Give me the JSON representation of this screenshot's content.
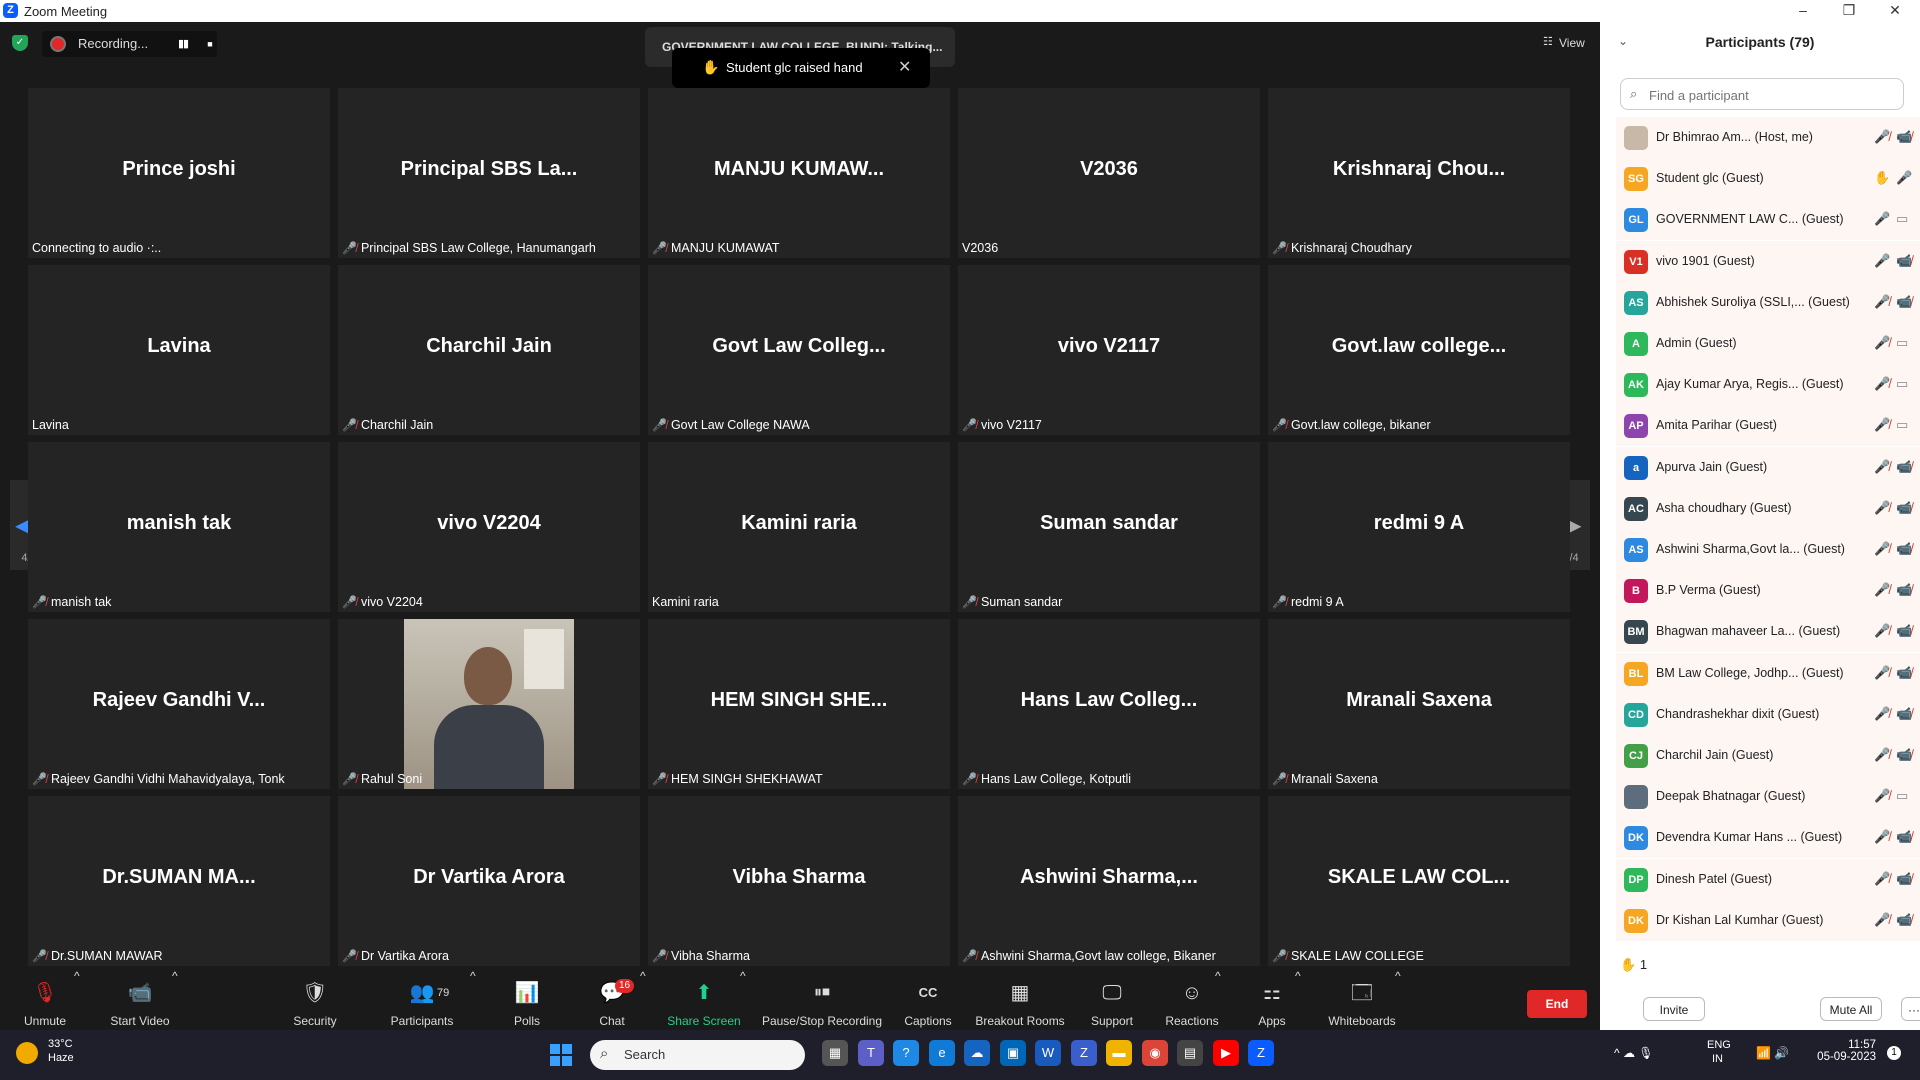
{
  "window": {
    "title": "Zoom Meeting",
    "minimize": "–",
    "restore": "❐",
    "close": "✕"
  },
  "recording": {
    "label": "Recording...",
    "pause": "▮▮",
    "stop": "■"
  },
  "speaker_banner": "GOVERNMENT LAW COLLEGE, BUNDI: Talking...",
  "notification": {
    "icon": "✋",
    "text": "Student glc raised hand",
    "close": "✕"
  },
  "view_button": {
    "icon": "☷",
    "label": "View"
  },
  "page_indicator": {
    "left": "4/4",
    "right": "4/4",
    "left_arrow": "◀",
    "right_arrow": "▶"
  },
  "tiles": [
    {
      "name": "Prince joshi",
      "label": "Connecting to audio ·:..",
      "muted": false
    },
    {
      "name": "Principal SBS La...",
      "label": "Principal SBS Law College, Hanumangarh",
      "muted": true
    },
    {
      "name": "MANJU  KUMAW...",
      "label": "MANJU KUMAWAT",
      "muted": true
    },
    {
      "name": "V2036",
      "label": "V2036",
      "muted": false
    },
    {
      "name": "Krishnaraj  Chou...",
      "label": "Krishnaraj Choudhary",
      "muted": true
    },
    {
      "name": "Lavina",
      "label": "Lavina",
      "muted": false
    },
    {
      "name": "Charchil Jain",
      "label": "Charchil Jain",
      "muted": true
    },
    {
      "name": "Govt  Law  Colleg...",
      "label": "Govt Law College NAWA",
      "muted": true
    },
    {
      "name": "vivo V2117",
      "label": "vivo V2117",
      "muted": true
    },
    {
      "name": "Govt.law  college...",
      "label": "Govt.law college, bikaner",
      "muted": true
    },
    {
      "name": "manish tak",
      "label": "manish tak",
      "muted": true
    },
    {
      "name": "vivo V2204",
      "label": "vivo V2204",
      "muted": true
    },
    {
      "name": "Kamini raria",
      "label": "Kamini raria",
      "muted": false
    },
    {
      "name": "Suman sandar",
      "label": "Suman sandar",
      "muted": true
    },
    {
      "name": "redmi 9 A",
      "label": "redmi 9 A",
      "muted": true
    },
    {
      "name": "Rajeev Gandhi V...",
      "label": "Rajeev Gandhi Vidhi Mahavidyalaya, Tonk",
      "muted": true
    },
    {
      "name": "",
      "label": "Rahul Soni",
      "muted": true,
      "video": true
    },
    {
      "name": "HEM SINGH SHE...",
      "label": "HEM SINGH SHEKHAWAT",
      "muted": true
    },
    {
      "name": "Hans Law Colleg...",
      "label": "Hans Law College, Kotputli",
      "muted": true
    },
    {
      "name": "Mranali Saxena",
      "label": "Mranali Saxena",
      "muted": true
    },
    {
      "name": "Dr.SUMAN  MA...",
      "label": "Dr.SUMAN MAWAR",
      "muted": true
    },
    {
      "name": "Dr Vartika Arora",
      "label": "Dr Vartika Arora",
      "muted": true
    },
    {
      "name": "Vibha Sharma",
      "label": "Vibha Sharma",
      "muted": true
    },
    {
      "name": "Ashwini  Sharma,...",
      "label": "Ashwini Sharma,Govt law college, Bikaner",
      "muted": true
    },
    {
      "name": "SKALE  LAW  COL...",
      "label": "SKALE LAW COLLEGE",
      "muted": true
    }
  ],
  "mute_glyph": "🎤̸",
  "toolbar": {
    "unmute": "Unmute",
    "start_video": "Start Video",
    "security": "Security",
    "participants": "Participants",
    "participants_count": "79",
    "polls": "Polls",
    "chat": "Chat",
    "chat_badge": "16",
    "share_screen": "Share Screen",
    "pause_stop_recording": "Pause/Stop Recording",
    "captions": "Captions",
    "breakout_rooms": "Breakout Rooms",
    "support": "Support",
    "reactions": "Reactions",
    "apps": "Apps",
    "whiteboards": "Whiteboards",
    "end": "End",
    "caret": "^",
    "icons": {
      "unmute": "🎙",
      "start_video": "📹",
      "security": "🛡",
      "participants": "👥",
      "polls": "📊",
      "chat": "💬",
      "share_screen": "⬆",
      "pause_stop_recording": "⏸⏹",
      "captions": "CC",
      "breakout_rooms": "▦",
      "support": "🖵",
      "reactions": "☺",
      "apps": "⚏",
      "whiteboards": "🗔"
    }
  },
  "panel": {
    "title": "Participants (79)",
    "collapse": "⌄",
    "search_placeholder": "Find a participant",
    "participants": [
      {
        "initials": "",
        "name": "Dr Bhimrao Am...  (Host, me)",
        "color": "#c8b8a8",
        "icon1": "🎤̸",
        "icon2": "📹̸"
      },
      {
        "initials": "SG",
        "name": "Student glc (Guest)",
        "color": "#f5a623",
        "icon1": "✋",
        "icon2": "🎤"
      },
      {
        "initials": "GL",
        "name": "GOVERNMENT LAW C...  (Guest)",
        "color": "#2d8ae0",
        "icon1": "🎤",
        "icon2": "▭"
      },
      {
        "initials": "V1",
        "name": "vivo 1901 (Guest)",
        "color": "#d93025",
        "icon1": "🎤",
        "icon2": "📹̸"
      },
      {
        "initials": "AS",
        "name": "Abhishek Suroliya (SSLI,...  (Guest)",
        "color": "#26a69a",
        "icon1": "🎤̸",
        "icon2": "📹̸"
      },
      {
        "initials": "A",
        "name": "Admin (Guest)",
        "color": "#2eb85c",
        "icon1": "🎤̸",
        "icon2": "▭"
      },
      {
        "initials": "AK",
        "name": "Ajay Kumar Arya, Regis...  (Guest)",
        "color": "#2eb85c",
        "icon1": "🎤̸",
        "icon2": "▭"
      },
      {
        "initials": "AP",
        "name": "Amita Parihar (Guest)",
        "color": "#8e44ad",
        "icon1": "🎤̸",
        "icon2": "▭"
      },
      {
        "initials": "a",
        "name": "Apurva Jain (Guest)",
        "color": "#1565c0",
        "icon1": "🎤̸",
        "icon2": "📹̸"
      },
      {
        "initials": "AC",
        "name": "Asha choudhary (Guest)",
        "color": "#37474f",
        "icon1": "🎤̸",
        "icon2": "📹̸"
      },
      {
        "initials": "AS",
        "name": "Ashwini Sharma,Govt la...  (Guest)",
        "color": "#2d8ae0",
        "icon1": "🎤̸",
        "icon2": "📹̸"
      },
      {
        "initials": "B",
        "name": "B.P Verma (Guest)",
        "color": "#c2185b",
        "icon1": "🎤̸",
        "icon2": "📹̸"
      },
      {
        "initials": "BM",
        "name": "Bhagwan mahaveer La...  (Guest)",
        "color": "#37474f",
        "icon1": "🎤̸",
        "icon2": "📹̸"
      },
      {
        "initials": "BL",
        "name": "BM Law College, Jodhp...  (Guest)",
        "color": "#f5a623",
        "icon1": "🎤̸",
        "icon2": "📹̸"
      },
      {
        "initials": "CD",
        "name": "Chandrashekhar dixit (Guest)",
        "color": "#26a69a",
        "icon1": "🎤̸",
        "icon2": "📹̸"
      },
      {
        "initials": "CJ",
        "name": "Charchil Jain (Guest)",
        "color": "#43a047",
        "icon1": "🎤̸",
        "icon2": "📹̸"
      },
      {
        "initials": "",
        "name": "Deepak Bhatnagar (Guest)",
        "color": "#5d6d7e",
        "icon1": "🎤̸",
        "icon2": "▭"
      },
      {
        "initials": "DK",
        "name": "Devendra Kumar Hans ...  (Guest)",
        "color": "#2d8ae0",
        "icon1": "🎤̸",
        "icon2": "📹̸"
      },
      {
        "initials": "DP",
        "name": "Dinesh Patel (Guest)",
        "color": "#2eb85c",
        "icon1": "🎤̸",
        "icon2": "📹̸"
      },
      {
        "initials": "DK",
        "name": "Dr Kishan Lal Kumhar (Guest)",
        "color": "#f5a623",
        "icon1": "🎤̸",
        "icon2": "📹̸"
      }
    ],
    "raised_hands": {
      "icon": "✋",
      "count": "1"
    },
    "invite": "Invite",
    "mute_all": "Mute All",
    "more": "···"
  },
  "taskbar": {
    "temperature": "33°C",
    "weather": "Haze",
    "search": "Search",
    "language": "ENG",
    "region": "IN",
    "time": "11:57",
    "date": "05-09-2023",
    "notification_count": "1",
    "tray_icons": "^  ☁  🎙",
    "net_icons": "📶 🔊",
    "search_glyph": "⌕",
    "apps": [
      {
        "name": "file-explorer",
        "glyph": "▦",
        "color": "#555"
      },
      {
        "name": "teams",
        "glyph": "T",
        "color": "#5b5fc7"
      },
      {
        "name": "help",
        "glyph": "?",
        "color": "#1e88e5"
      },
      {
        "name": "edge",
        "glyph": "e",
        "color": "#0f7bd6"
      },
      {
        "name": "onedrive",
        "glyph": "☁",
        "color": "#1565c0"
      },
      {
        "name": "store",
        "glyph": "▣",
        "color": "#0067b8"
      },
      {
        "name": "word",
        "glyph": "W",
        "color": "#185abd"
      },
      {
        "name": "app2",
        "glyph": "Z",
        "color": "#3a5fcd"
      },
      {
        "name": "folder",
        "glyph": "▬",
        "color": "#f0b400"
      },
      {
        "name": "chrome",
        "glyph": "◉",
        "color": "#db4437"
      },
      {
        "name": "calculator",
        "glyph": "▤",
        "color": "#444"
      },
      {
        "name": "youtube",
        "glyph": "▶",
        "color": "#ff0000"
      },
      {
        "name": "zoom",
        "glyph": "Z",
        "color": "#0b5cff"
      }
    ]
  }
}
